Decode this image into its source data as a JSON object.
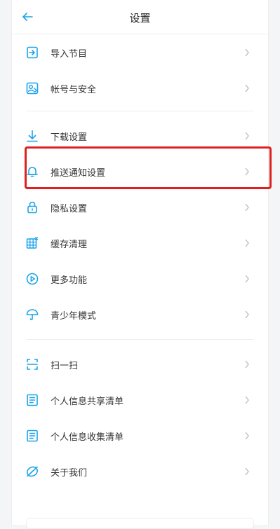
{
  "header": {
    "title": "设置"
  },
  "colors": {
    "accent": "#1aa3ea",
    "highlight": "#e02020"
  },
  "items": [
    {
      "label": "导入节目",
      "icon": "import-icon"
    },
    {
      "label": "帐号与安全",
      "icon": "account-security-icon"
    },
    {
      "label": "下载设置",
      "icon": "download-icon"
    },
    {
      "label": "推送通知设置",
      "icon": "bell-icon"
    },
    {
      "label": "隐私设置",
      "icon": "lock-icon"
    },
    {
      "label": "缓存清理",
      "icon": "cache-icon"
    },
    {
      "label": "更多功能",
      "icon": "play-circle-icon"
    },
    {
      "label": "青少年模式",
      "icon": "umbrella-icon"
    },
    {
      "label": "扫一扫",
      "icon": "scan-icon"
    },
    {
      "label": "个人信息共享清单",
      "icon": "list-doc-icon"
    },
    {
      "label": "个人信息收集清单",
      "icon": "list-doc-icon"
    },
    {
      "label": "关于我们",
      "icon": "about-icon"
    }
  ]
}
